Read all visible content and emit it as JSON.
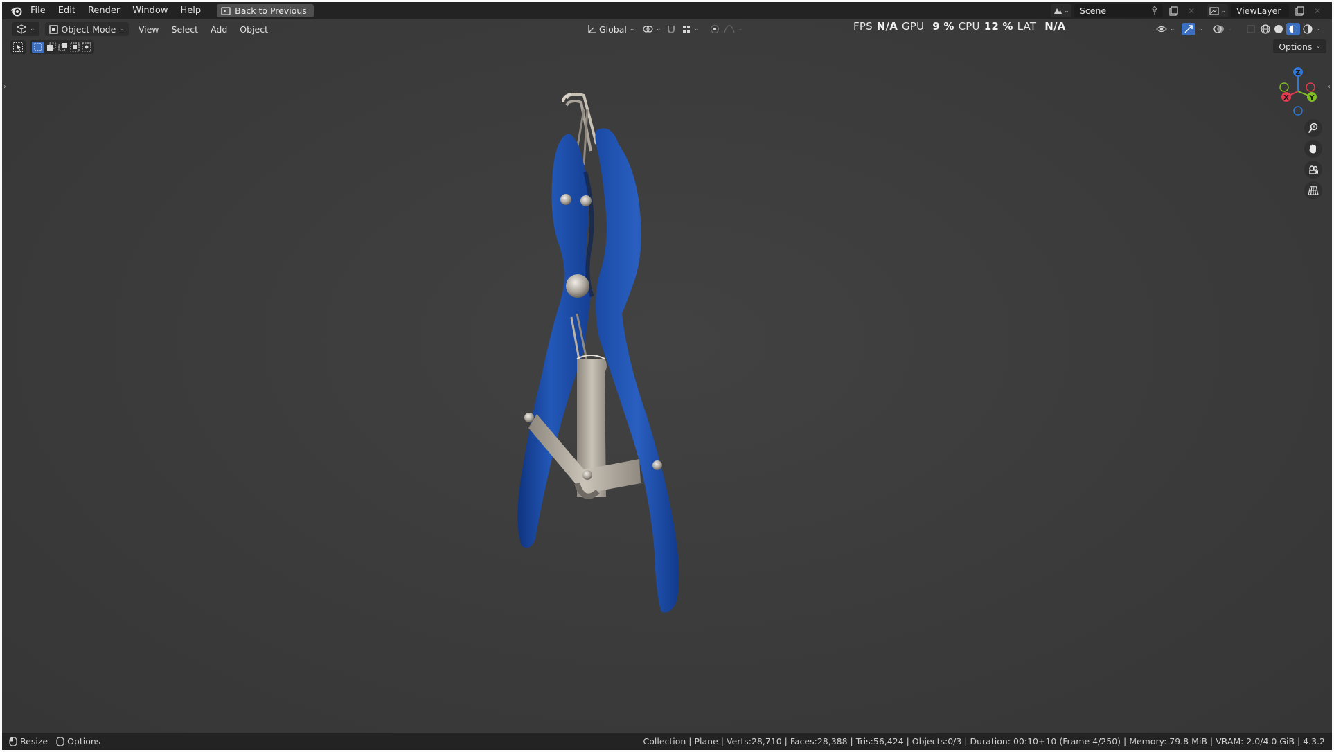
{
  "menu": {
    "file": "File",
    "edit": "Edit",
    "render": "Render",
    "window": "Window",
    "help": "Help",
    "back_to_previous": "Back to Previous"
  },
  "scene": {
    "name": "Scene",
    "view_layer": "ViewLayer"
  },
  "viewport_header": {
    "mode": "Object Mode",
    "view": "View",
    "select": "Select",
    "add": "Add",
    "object": "Object",
    "transform_orientation": "Global",
    "options": "Options"
  },
  "perf": {
    "fps_label": "FPS",
    "fps_value": "N/A",
    "gpu_label": "GPU",
    "gpu_value": "9 %",
    "cpu_label": "CPU",
    "cpu_value": "12 %",
    "lat_label": "LAT",
    "lat_value": "N/A"
  },
  "gizmo": {
    "x": "X",
    "y": "Y",
    "z": "Z"
  },
  "status": {
    "resize": "Resize",
    "options": "Options",
    "info": "Collection | Plane | Verts:28,710 | Faces:28,388 | Tris:56,424 | Objects:0/3 | Duration: 00:10+10 (Frame 4/250) | Memory: 79.8 MiB | VRAM: 2.0/4.0 GiB | 4.3.2"
  },
  "colors": {
    "background": "#3c3c3c",
    "handle_blue": "#1e4fa6",
    "metal": "#b8b2a8",
    "axis_x": "#e33a4f",
    "axis_y": "#7fbf24",
    "axis_z": "#2e78d9"
  }
}
